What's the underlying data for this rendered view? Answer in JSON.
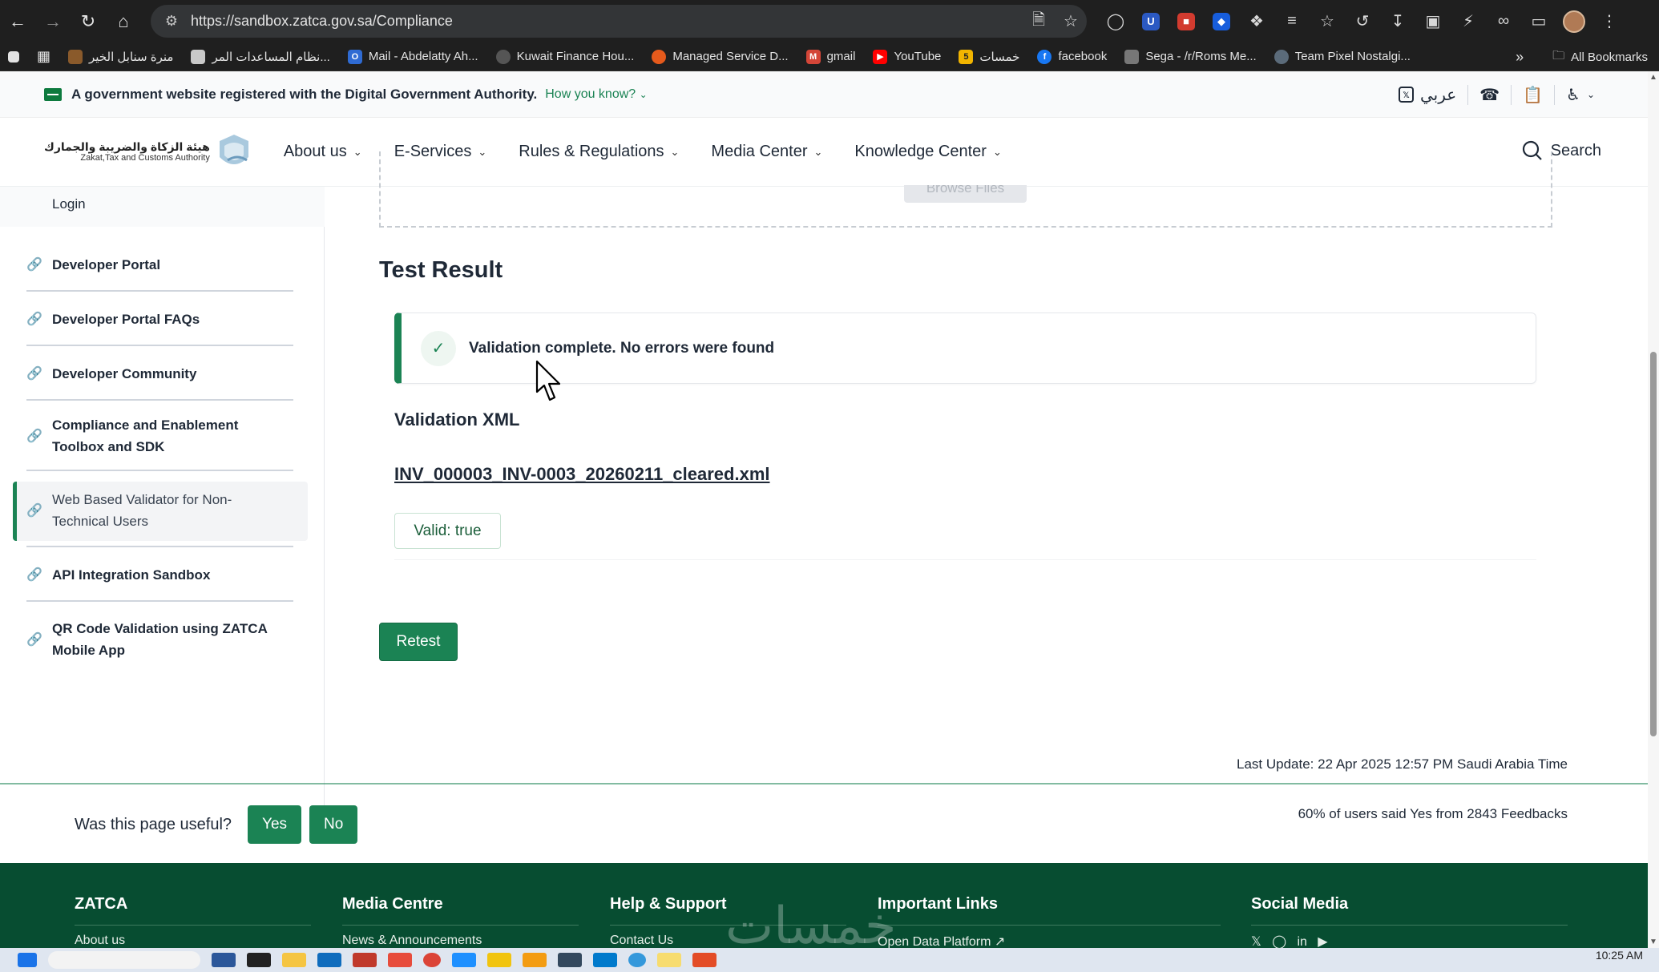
{
  "browser": {
    "url": "https://sandbox.zatca.gov.sa/Compliance",
    "bookmarks": [
      {
        "label": "منرة سنابل الخير",
        "color": "#8a5a2b"
      },
      {
        "label": "نظام المساعدات المر...",
        "color": "#c8c8c8"
      },
      {
        "label": "Mail - Abdelatty Ah...",
        "color": "#2f6bd3"
      },
      {
        "label": "Kuwait Finance Hou...",
        "color": "#555555"
      },
      {
        "label": "Managed Service D...",
        "color": "#e55a1c"
      },
      {
        "label": "gmail",
        "color": "#d44638"
      },
      {
        "label": "YouTube",
        "color": "#ff0000"
      },
      {
        "label": "خمسات",
        "color": "#f2b500"
      },
      {
        "label": "facebook",
        "color": "#1877f2"
      },
      {
        "label": "Sega - /r/Roms Me...",
        "color": "#777777"
      },
      {
        "label": "Team Pixel Nostalgi...",
        "color": "#5b6b7a"
      }
    ],
    "all_bookmarks": "All Bookmarks"
  },
  "gov_banner": {
    "text": "A government website registered with the Digital Government Authority.",
    "how_link": "How you know?",
    "lang": "عربي"
  },
  "header": {
    "logo_ar": "هيئة الزكاة والضريبة والجمارك",
    "logo_en": "Zakat,Tax and Customs Authority",
    "nav": [
      "About us",
      "E-Services",
      "Rules & Regulations",
      "Media Center",
      "Knowledge Center"
    ],
    "search": "Search"
  },
  "sidebar": {
    "login": "Login",
    "items": [
      {
        "label": "Developer Portal"
      },
      {
        "label": "Developer Portal FAQs"
      },
      {
        "label": "Developer Community"
      },
      {
        "label": "Compliance and Enablement Toolbox and SDK"
      },
      {
        "label": "Web Based Validator for Non-Technical Users"
      },
      {
        "label": "API Integration Sandbox"
      },
      {
        "label": "QR Code Validation using ZATCA Mobile App"
      }
    ]
  },
  "main": {
    "browse_files": "Browse Files",
    "test_result_title": "Test Result",
    "alert_text": "Validation complete. No errors were found",
    "validation_xml_label": "Validation XML",
    "xml_file": "INV_000003_INV-0003_20260211_cleared.xml",
    "valid_badge": "Valid: true",
    "retest": "Retest",
    "last_update": "Last Update: 22 Apr 2025 12:57 PM Saudi Arabia Time"
  },
  "feedback": {
    "question": "Was this page useful?",
    "yes": "Yes",
    "no": "No",
    "stat": "60% of users said Yes from 2843 Feedbacks"
  },
  "footer": {
    "columns": [
      {
        "title": "ZATCA",
        "first": "About us"
      },
      {
        "title": "Media Centre",
        "first": "News & Announcements"
      },
      {
        "title": "Help & Support",
        "first": "Contact Us"
      },
      {
        "title": "Important Links",
        "first": "Open Data Platform"
      },
      {
        "title": "Social Media",
        "first": ""
      }
    ],
    "watermark": "خمسات"
  },
  "taskbar": {
    "time": "10:25 AM"
  },
  "colors": {
    "brand_green": "#1b8354",
    "footer_green": "#074d31"
  }
}
